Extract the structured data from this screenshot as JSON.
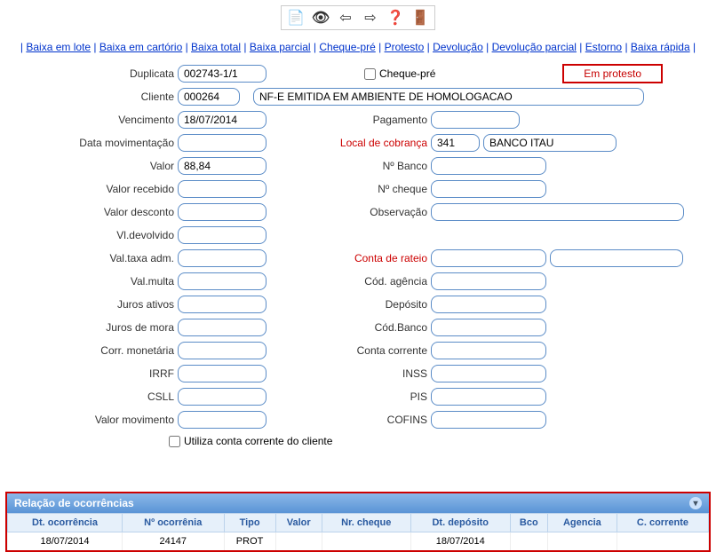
{
  "links": {
    "baixa_lote": "Baixa em lote",
    "baixa_cartorio": "Baixa em cartório",
    "baixa_total": "Baixa total",
    "baixa_parcial": "Baixa parcial",
    "cheque_pre": "Cheque-pré",
    "protesto": "Protesto",
    "devolucao": "Devolução",
    "devolucao_parcial": "Devolução parcial",
    "estorno": "Estorno",
    "baixa_rapida": "Baixa rápida"
  },
  "labels": {
    "duplicata": "Duplicata",
    "cheque_pre_chk": "Cheque-pré",
    "status": "Em protesto",
    "cliente": "Cliente",
    "vencimento": "Vencimento",
    "pagamento": "Pagamento",
    "data_mov": "Data movimentação",
    "local_cobranca": "Local de cobrança",
    "valor": "Valor",
    "n_banco": "Nº Banco",
    "valor_recebido": "Valor recebido",
    "n_cheque": "Nº cheque",
    "valor_desconto": "Valor desconto",
    "observacao": "Observação",
    "vl_devolvido": "Vl.devolvido",
    "val_taxa_adm": "Val.taxa adm.",
    "conta_rateio": "Conta de rateio",
    "val_multa": "Val.multa",
    "cod_agencia": "Cód. agência",
    "juros_ativos": "Juros ativos",
    "deposito": "Depósito",
    "juros_mora": "Juros de mora",
    "cod_banco": "Cód.Banco",
    "corr_monetaria": "Corr. monetária",
    "conta_corrente": "Conta corrente",
    "irrf": "IRRF",
    "inss": "INSS",
    "csll": "CSLL",
    "pis": "PIS",
    "valor_movimento": "Valor movimento",
    "cofins": "COFINS",
    "utiliza_cc": "Utiliza conta corrente do cliente"
  },
  "values": {
    "duplicata": "002743-1/1",
    "cliente_cod": "000264",
    "cliente_nome": "NF-E EMITIDA EM AMBIENTE DE HOMOLOGACAO",
    "vencimento": "18/07/2014",
    "pagamento": "",
    "data_mov": "",
    "local_cob_cod": "341",
    "local_cob_nome": "BANCO ITAU",
    "valor": "88,84",
    "n_banco": "",
    "valor_recebido": "",
    "n_cheque": "",
    "valor_desconto": "",
    "observacao": "",
    "vl_devolvido": "",
    "val_taxa_adm": "",
    "conta_rateio_cod": "",
    "conta_rateio_nome": "",
    "val_multa": "",
    "cod_agencia": "",
    "juros_ativos": "",
    "deposito": "",
    "juros_mora": "",
    "cod_banco": "",
    "corr_monetaria": "",
    "conta_corrente": "",
    "irrf": "",
    "inss": "",
    "csll": "",
    "pis": "",
    "valor_movimento": "",
    "cofins": ""
  },
  "grid": {
    "title": "Relação de ocorrências",
    "headers": {
      "dt_ocorrencia": "Dt. ocorrência",
      "n_ocorrencia": "Nº ocorrênia",
      "tipo": "Tipo",
      "valor": "Valor",
      "nr_cheque": "Nr. cheque",
      "dt_deposito": "Dt. depósito",
      "bco": "Bco",
      "agencia": "Agencia",
      "c_corrente": "C. corrente"
    },
    "rows": [
      {
        "dt_ocorrencia": "18/07/2014",
        "n_ocorrencia": "24147",
        "tipo": "PROT",
        "valor": "",
        "nr_cheque": "",
        "dt_deposito": "18/07/2014",
        "bco": "",
        "agencia": "",
        "c_corrente": ""
      }
    ]
  }
}
